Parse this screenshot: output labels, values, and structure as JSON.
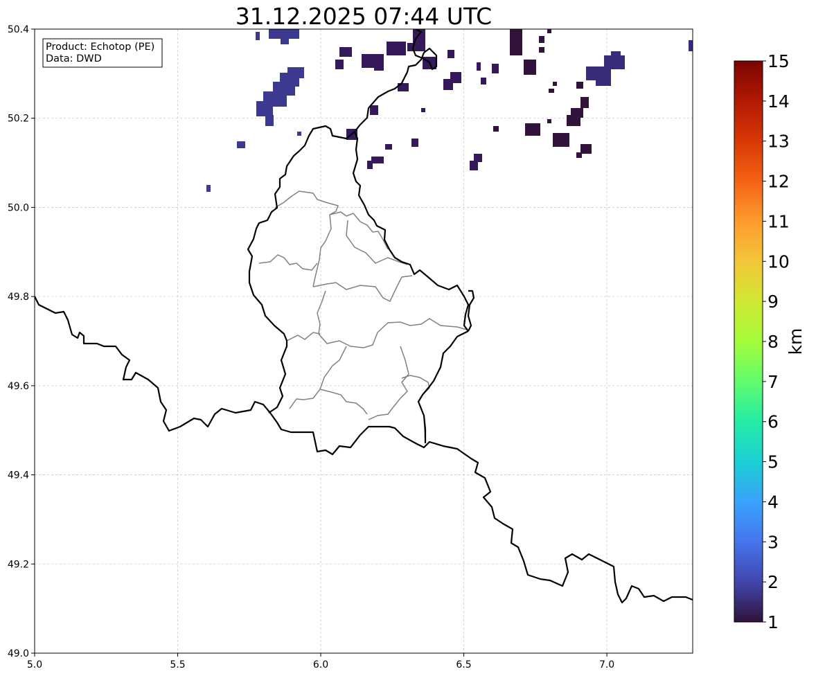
{
  "title": "31.12.2025 07:44 UTC",
  "info_box": {
    "product": "Product: Echotop (PE)",
    "data": "Data: DWD"
  },
  "map": {
    "lon_range": [
      5.0,
      7.3
    ],
    "lat_range": [
      49.0,
      50.4
    ],
    "x_ticks": [
      "5.0",
      "5.5",
      "6.0",
      "6.5",
      "7.0"
    ],
    "y_ticks": [
      "49.0",
      "49.2",
      "49.4",
      "49.6",
      "49.8",
      "50.0",
      "50.2",
      "50.4"
    ],
    "grid": true,
    "grid_style": "dashed light gray",
    "national_border_color": "#000000",
    "canton_border_color": "#808080"
  },
  "colorbar": {
    "label": "km",
    "ticks": [
      "1",
      "2",
      "3",
      "4",
      "5",
      "6",
      "7",
      "8",
      "9",
      "10",
      "11",
      "12",
      "13",
      "14",
      "15"
    ],
    "range": [
      1,
      15
    ],
    "colormap": "turbo",
    "colors": [
      "#30123b",
      "#4145ab",
      "#4675ed",
      "#39a2fc",
      "#1bcfd4",
      "#24eca6",
      "#61fc6c",
      "#a4fc3b",
      "#d1e834",
      "#f3c63a",
      "#fe9b2d",
      "#f36315",
      "#d93806",
      "#b11901",
      "#7a0402"
    ]
  },
  "echo_regions": [
    {
      "name": "northwest-cluster",
      "value_km": 2.2
    },
    {
      "name": "north-center-cluster",
      "value_km": 1.3
    },
    {
      "name": "northeast-cluster",
      "value_km": 1.6
    },
    {
      "name": "scattered-cells",
      "value_km": 1.1
    }
  ]
}
